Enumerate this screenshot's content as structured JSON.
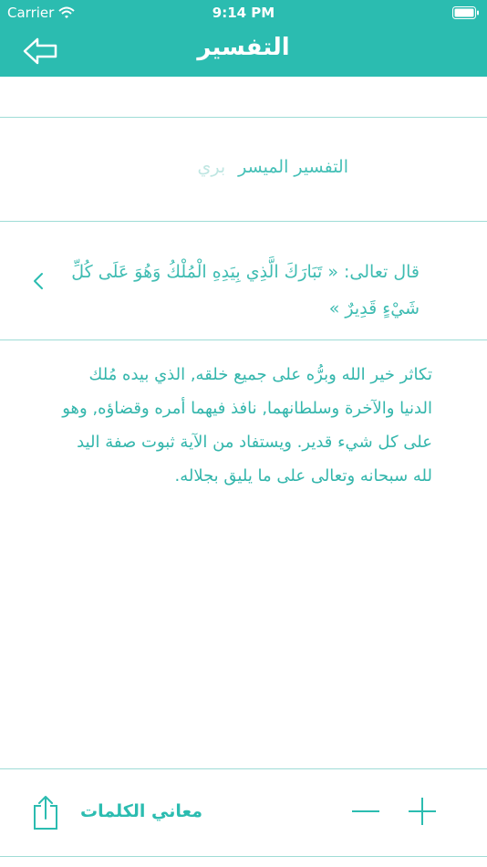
{
  "status_bar": {
    "carrier": "Carrier",
    "time": "9:14 PM"
  },
  "nav": {
    "title": "التفسير"
  },
  "tafsir_tabs": {
    "active": "التفسير الميسر",
    "faded": "بري"
  },
  "verse": {
    "text": "قال تعالى: « تَبَارَكَ الَّذِي بِيَدِهِ الْمُلْكُ وَهُوَ عَلَى كُلِّ شَيْءٍ قَدِيرٌ »"
  },
  "tafsir": {
    "text": "تكاثر خير الله وبرُّه على جميع خلقه, الذي بيده مُلك الدنيا والآخرة وسلطانهما, نافذ فيهما أمره وقضاؤه, وهو على كل شيء قدير. ويستفاد من الآية ثبوت صفة اليد لله سبحانه وتعالى على ما يليق بجلاله."
  },
  "bottom_bar": {
    "word_meanings": "معاني الكلمات"
  },
  "colors": {
    "accent": "#2bbcb0",
    "text": "#34b6ac",
    "separator": "#9fdcd6"
  },
  "icons": [
    "wifi-icon",
    "battery-icon",
    "back-arrow-icon",
    "chevron-left-icon",
    "share-icon",
    "minus-icon",
    "plus-icon"
  ]
}
